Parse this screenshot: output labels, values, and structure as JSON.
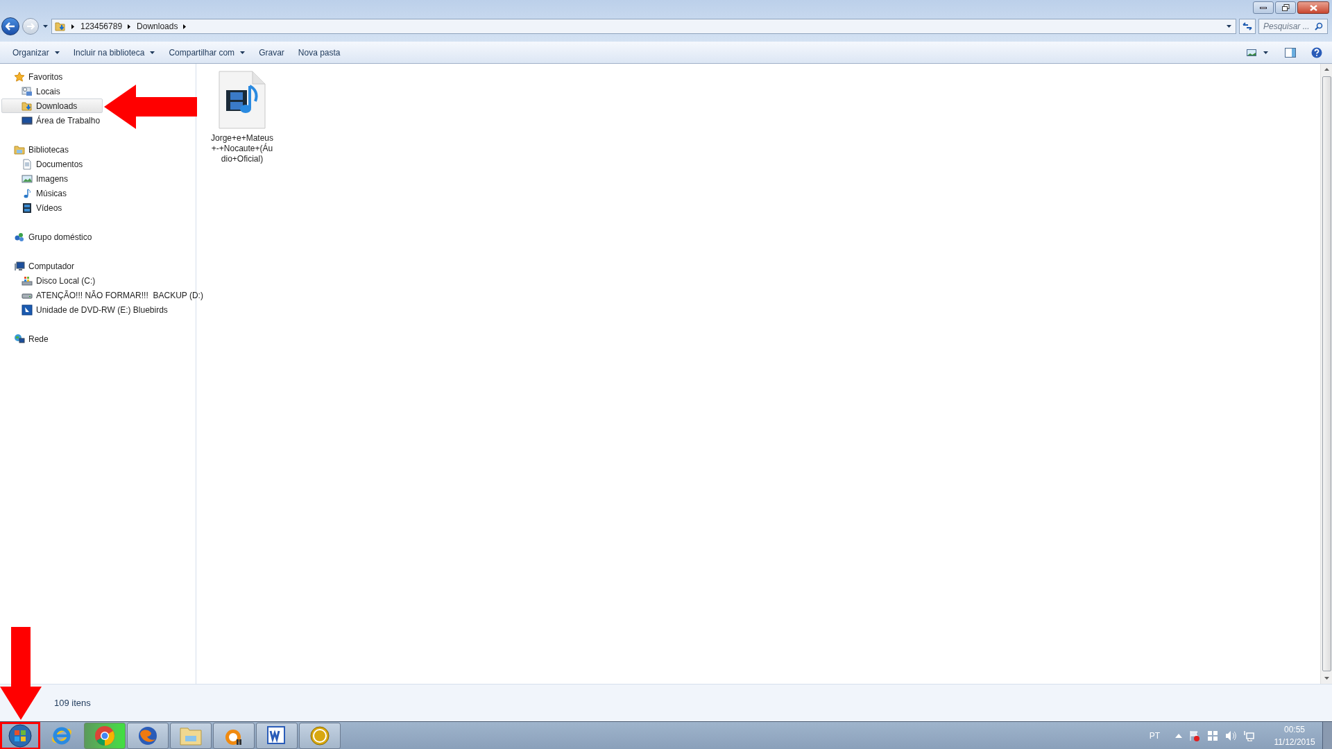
{
  "address_bar": {
    "crumbs": [
      "123456789",
      "Downloads"
    ]
  },
  "search": {
    "placeholder": "Pesquisar ..."
  },
  "toolbar": {
    "items": [
      {
        "label": "Organizar",
        "dropdown": true
      },
      {
        "label": "Incluir na biblioteca",
        "dropdown": true
      },
      {
        "label": "Compartilhar com",
        "dropdown": true
      },
      {
        "label": "Gravar",
        "dropdown": false
      },
      {
        "label": "Nova pasta",
        "dropdown": false
      }
    ]
  },
  "sidebar": {
    "groups": [
      {
        "label": "Favoritos",
        "kind": "star",
        "children": [
          {
            "label": "Locais",
            "kind": "recent",
            "selected": false
          },
          {
            "label": "Downloads",
            "kind": "downloads",
            "selected": true
          },
          {
            "label": "Área de Trabalho",
            "kind": "desktop",
            "selected": false
          }
        ]
      },
      {
        "label": "Bibliotecas",
        "kind": "library",
        "children": [
          {
            "label": "Documentos",
            "kind": "document",
            "selected": false
          },
          {
            "label": "Imagens",
            "kind": "picture",
            "selected": false
          },
          {
            "label": "Músicas",
            "kind": "music",
            "selected": false
          },
          {
            "label": "Vídeos",
            "kind": "video",
            "selected": false
          }
        ]
      },
      {
        "label": "Grupo doméstico",
        "kind": "homegroup"
      },
      {
        "label": "Computador",
        "kind": "computer",
        "children": [
          {
            "label": "Disco Local (C:)",
            "kind": "system-drive",
            "selected": false
          },
          {
            "label": "ATENÇÃO!!! NÃO FORMAR!!!  BACKUP (D:)",
            "kind": "drive",
            "selected": false
          },
          {
            "label": "Unidade de DVD-RW (E:) Bluebirds",
            "kind": "dvd",
            "selected": false
          }
        ]
      },
      {
        "label": "Rede",
        "kind": "network"
      }
    ]
  },
  "files": [
    {
      "name": "Jorge+e+Mateus +-+Nocaute+(Áu dio+Oficial)"
    }
  ],
  "status_bar": {
    "text": "109 itens"
  },
  "taskbar": {
    "language": "PT",
    "time": "00:55",
    "date": "11/12/2015"
  }
}
